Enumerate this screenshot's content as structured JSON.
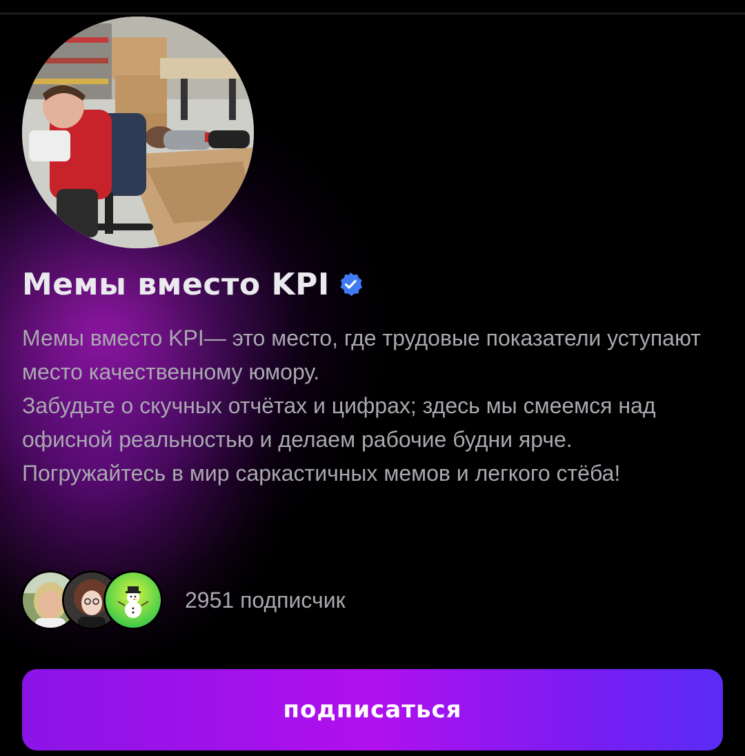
{
  "channel": {
    "title": "Мемы вместо KPI",
    "verified_icon": "verified-badge-icon",
    "description": [
      "Мемы вместо KPI— это место, где трудовые показатели уступают место качественному юмору.",
      "Забудьте о скучных отчётах и цифрах; здесь мы смеемся над офисной реальностью и делаем рабочие будни ярче.",
      "Погружайтесь в мир саркастичных мемов и легкого стёба!"
    ],
    "subscribers_text": "2951 подписчик",
    "subscriber_avatars": [
      "avatar-woman-blonde",
      "avatar-person-curly-hair",
      "avatar-snowman-emoji"
    ],
    "subscribe_label": "подписаться"
  },
  "colors": {
    "background": "#000000",
    "accent_gradient_start": "#8a14e6",
    "accent_gradient_end": "#5a2cf6",
    "verified_blue": "#3f7bf5",
    "title": "#e9e9ee",
    "secondary_text": "#a9a9b0"
  }
}
